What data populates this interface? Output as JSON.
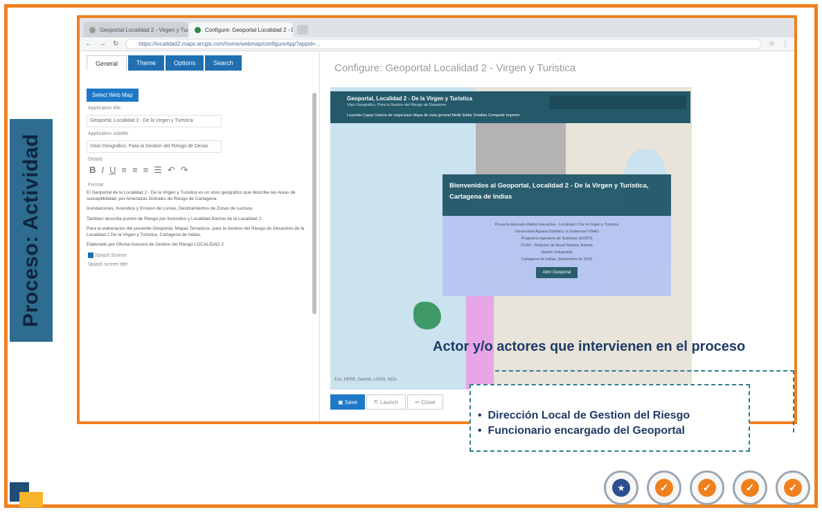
{
  "side_label": "Proceso:  Actividad",
  "browser": {
    "tabs": [
      {
        "label": "Geoportal Localidad 2 - Virgen y Tur..."
      },
      {
        "label": "Configure: Geoportal Localidad 2 - De..."
      }
    ],
    "url": "https://localidad2.maps.arcgis.com/home/webmap/configureApp?appid=..."
  },
  "left_panel": {
    "tabs": [
      "General",
      "Theme",
      "Options",
      "Search"
    ],
    "select_map_button": "Select Web Map",
    "app_title_label": "Application title",
    "app_title_value": "Geoportal, Localidad 2 - De la Virgen y Turistica",
    "app_subtitle_label": "Application subtitle",
    "app_subtitle_value": "Visor Geografico, Para la Gestion del Riesgo de Desas",
    "details_label": "Details",
    "format_label": "Format",
    "body_paragraphs": [
      "El Geoportal de la Localidad 2 - De la Virgen y Turistica es un visor geografico que describe las Areas de susceptibilidad, por Amenazas Distrales de Riesgo de Cartagena.",
      "Inundaciones, Incendios y Erosion de Lomas, Deslizamientos de Zonas de Lectura.",
      "Tambien describe puntos de Riesgo por Incendios y Localidad Barrios de la Localidad 2.",
      "Para la elaboracion del presente Geoportal, Mapas Tematicos, para la Gestion del Riesgo de Desastres de la Localidad 2 De la Virgen y Turistica, Cartagena de Indias.",
      "Elaborado por Oficina Asesora de Gestion del Riesgo LOCALIDAD 2"
    ],
    "splash_screen_label": "Splash Screen",
    "splash_title_label": "Splash screen title"
  },
  "config_title": "Configure: Geoportal Localidad 2 - Virgen y Turistica",
  "map": {
    "header_title": "Geoportal, Localidad 2 - De la Virgen y Turistica",
    "header_subtitle": "Visor Geografico, Para la Gestion del Riesgo de Desastres",
    "tools": "Leyenda  Capas  Galeria de mapa base  Mapa de vista general  Medir  Editar  Detalles  Compartir  Imprimir",
    "welcome_title": "Bienvenidos al Geoportal, Localidad 2 - De la Virgen y Turistica, Cartagena de Indias",
    "welcome_lines": [
      "Proyecto Aplicado Matria Interactiva - Localidad 2 De la Virgen y Turistica",
      "Universidad Agraria Distrital y la Gobernaci UNAD",
      "Programa Ingenieria de Sistemas (ECBTI)",
      "CCAV - Relacion de Abuel Netzbor Ramos",
      "Diseño (Infografia)",
      "Cartagena de Indias, Septiembre de 2019"
    ],
    "welcome_button": "Abrir Geoportal",
    "attribution": "Esri, HERE, Garmin, USGS, NGA"
  },
  "bottom_buttons": {
    "save": "Save",
    "launch": "Launch",
    "close": "Close"
  },
  "actor_title": "Actor y/o actores que intervienen en el proceso",
  "actors": [
    "Dirección Local de Gestion del Riesgo",
    "Funcionario  encargado del Geoportal"
  ],
  "logos": [
    {
      "icon": "colombia-seal-icon",
      "glyph": "★"
    },
    {
      "icon": "certification-icon",
      "glyph": "✓"
    },
    {
      "icon": "certification-icon",
      "glyph": "✓"
    },
    {
      "icon": "certification-icon",
      "glyph": "✓"
    },
    {
      "icon": "certification-icon",
      "glyph": "✓"
    }
  ],
  "colors": {
    "frame": "#f07f1e",
    "side_label_bg": "#2e6d8f",
    "title": "#1f3b66",
    "map_header": "#24596a"
  }
}
